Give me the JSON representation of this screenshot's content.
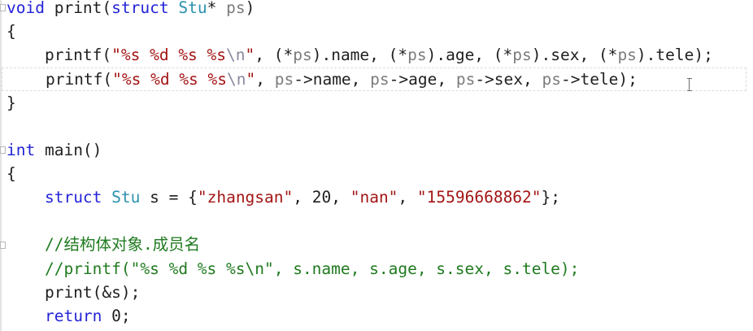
{
  "editor": {
    "lines": [
      {
        "segments": [
          {
            "t": "void",
            "c": "kw"
          },
          {
            "t": " print(",
            "c": ""
          },
          {
            "t": "struct",
            "c": "kw"
          },
          {
            "t": " ",
            "c": ""
          },
          {
            "t": "Stu",
            "c": "ty"
          },
          {
            "t": "* ",
            "c": ""
          },
          {
            "t": "ps",
            "c": "par"
          },
          {
            "t": ")",
            "c": ""
          }
        ]
      },
      {
        "segments": [
          {
            "t": "{",
            "c": ""
          }
        ]
      },
      {
        "segments": [
          {
            "t": "    printf(",
            "c": ""
          },
          {
            "t": "\"%s %d %s %s",
            "c": "str"
          },
          {
            "t": "\\n",
            "c": "esc"
          },
          {
            "t": "\"",
            "c": "str"
          },
          {
            "t": ", (*",
            "c": ""
          },
          {
            "t": "ps",
            "c": "par"
          },
          {
            "t": ").name, (*",
            "c": ""
          },
          {
            "t": "ps",
            "c": "par"
          },
          {
            "t": ").age, (*",
            "c": ""
          },
          {
            "t": "ps",
            "c": "par"
          },
          {
            "t": ").sex, (*",
            "c": ""
          },
          {
            "t": "ps",
            "c": "par"
          },
          {
            "t": ").tele);",
            "c": ""
          }
        ]
      },
      {
        "segments": [
          {
            "t": "    printf(",
            "c": ""
          },
          {
            "t": "\"%s %d %s %s",
            "c": "str"
          },
          {
            "t": "\\n",
            "c": "esc"
          },
          {
            "t": "\"",
            "c": "str"
          },
          {
            "t": ", ",
            "c": ""
          },
          {
            "t": "ps",
            "c": "par"
          },
          {
            "t": "->name, ",
            "c": ""
          },
          {
            "t": "ps",
            "c": "par"
          },
          {
            "t": "->age, ",
            "c": ""
          },
          {
            "t": "ps",
            "c": "par"
          },
          {
            "t": "->sex, ",
            "c": ""
          },
          {
            "t": "ps",
            "c": "par"
          },
          {
            "t": "->tele);",
            "c": ""
          }
        ]
      },
      {
        "segments": [
          {
            "t": "}",
            "c": ""
          }
        ]
      },
      {
        "segments": [
          {
            "t": "",
            "c": ""
          }
        ]
      },
      {
        "segments": [
          {
            "t": "int",
            "c": "kw"
          },
          {
            "t": " main()",
            "c": ""
          }
        ]
      },
      {
        "segments": [
          {
            "t": "{",
            "c": ""
          }
        ]
      },
      {
        "segments": [
          {
            "t": "    ",
            "c": ""
          },
          {
            "t": "struct",
            "c": "kw"
          },
          {
            "t": " ",
            "c": ""
          },
          {
            "t": "Stu",
            "c": "ty"
          },
          {
            "t": " s = {",
            "c": ""
          },
          {
            "t": "\"zhangsan\"",
            "c": "str"
          },
          {
            "t": ", 20, ",
            "c": ""
          },
          {
            "t": "\"nan\"",
            "c": "str"
          },
          {
            "t": ", ",
            "c": ""
          },
          {
            "t": "\"15596668862\"",
            "c": "str"
          },
          {
            "t": "};",
            "c": ""
          }
        ]
      },
      {
        "segments": [
          {
            "t": "",
            "c": ""
          }
        ]
      },
      {
        "segments": [
          {
            "t": "    //结构体对象.成员名",
            "c": "cmt"
          }
        ]
      },
      {
        "segments": [
          {
            "t": "    //printf(\"%s %d %s %s\\n\", s.name, s.age, s.sex, s.tele);",
            "c": "cmt"
          }
        ]
      },
      {
        "segments": [
          {
            "t": "    print(&s);",
            "c": ""
          }
        ]
      },
      {
        "segments": [
          {
            "t": "    ",
            "c": ""
          },
          {
            "t": "return",
            "c": "kw"
          },
          {
            "t": " 0;",
            "c": ""
          }
        ]
      }
    ]
  }
}
